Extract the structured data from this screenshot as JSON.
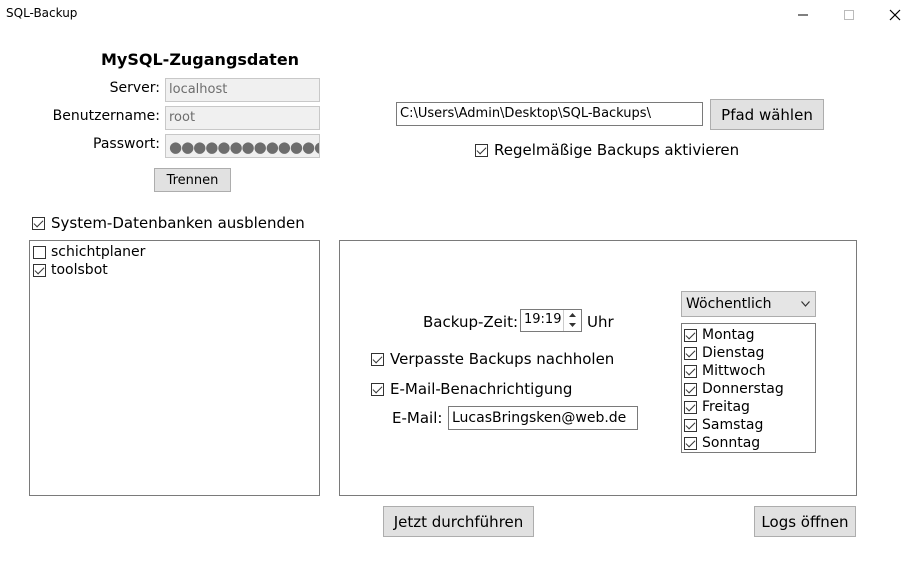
{
  "window": {
    "title": "SQL-Backup"
  },
  "credentials": {
    "title": "MySQL-Zugangsdaten",
    "server_label": "Server:",
    "server_value": "localhost",
    "user_label": "Benutzername:",
    "user_value": "root",
    "password_label": "Passwort:",
    "password_mask": "●●●●●●●●●●●●●●",
    "disconnect_label": "Trennen"
  },
  "path": {
    "value": "C:\\Users\\Admin\\Desktop\\SQL-Backups\\",
    "choose_label": "Pfad wählen",
    "regular_backups_label": "Regelmäßige Backups aktivieren",
    "regular_backups_checked": true
  },
  "databases": {
    "hide_system_label": "System-Datenbanken ausblenden",
    "hide_system_checked": true,
    "items": [
      {
        "name": "schichtplaner",
        "checked": false
      },
      {
        "name": "toolsbot",
        "checked": true
      }
    ]
  },
  "schedule": {
    "time_label": "Backup-Zeit:",
    "time_value": "19:19",
    "time_unit": "Uhr",
    "frequency": "Wöchentlich",
    "catch_up_label": "Verpasste Backups nachholen",
    "catch_up_checked": true,
    "email_notify_label": "E-Mail-Benachrichtigung",
    "email_notify_checked": true,
    "email_label": "E-Mail:",
    "email_value": "LucasBringsken@web.de",
    "days": [
      {
        "name": "Montag",
        "checked": true
      },
      {
        "name": "Dienstag",
        "checked": true
      },
      {
        "name": "Mittwoch",
        "checked": true
      },
      {
        "name": "Donnerstag",
        "checked": true
      },
      {
        "name": "Freitag",
        "checked": true
      },
      {
        "name": "Samstag",
        "checked": true
      },
      {
        "name": "Sonntag",
        "checked": true
      }
    ]
  },
  "actions": {
    "run_now_label": "Jetzt durchführen",
    "open_logs_label": "Logs öffnen"
  },
  "icons": {
    "minimize": "minimize-icon",
    "maximize": "maximize-icon",
    "close": "close-icon",
    "dropdown": "chevron-down-icon",
    "spin_up": "spin-up-icon",
    "spin_down": "spin-down-icon"
  }
}
